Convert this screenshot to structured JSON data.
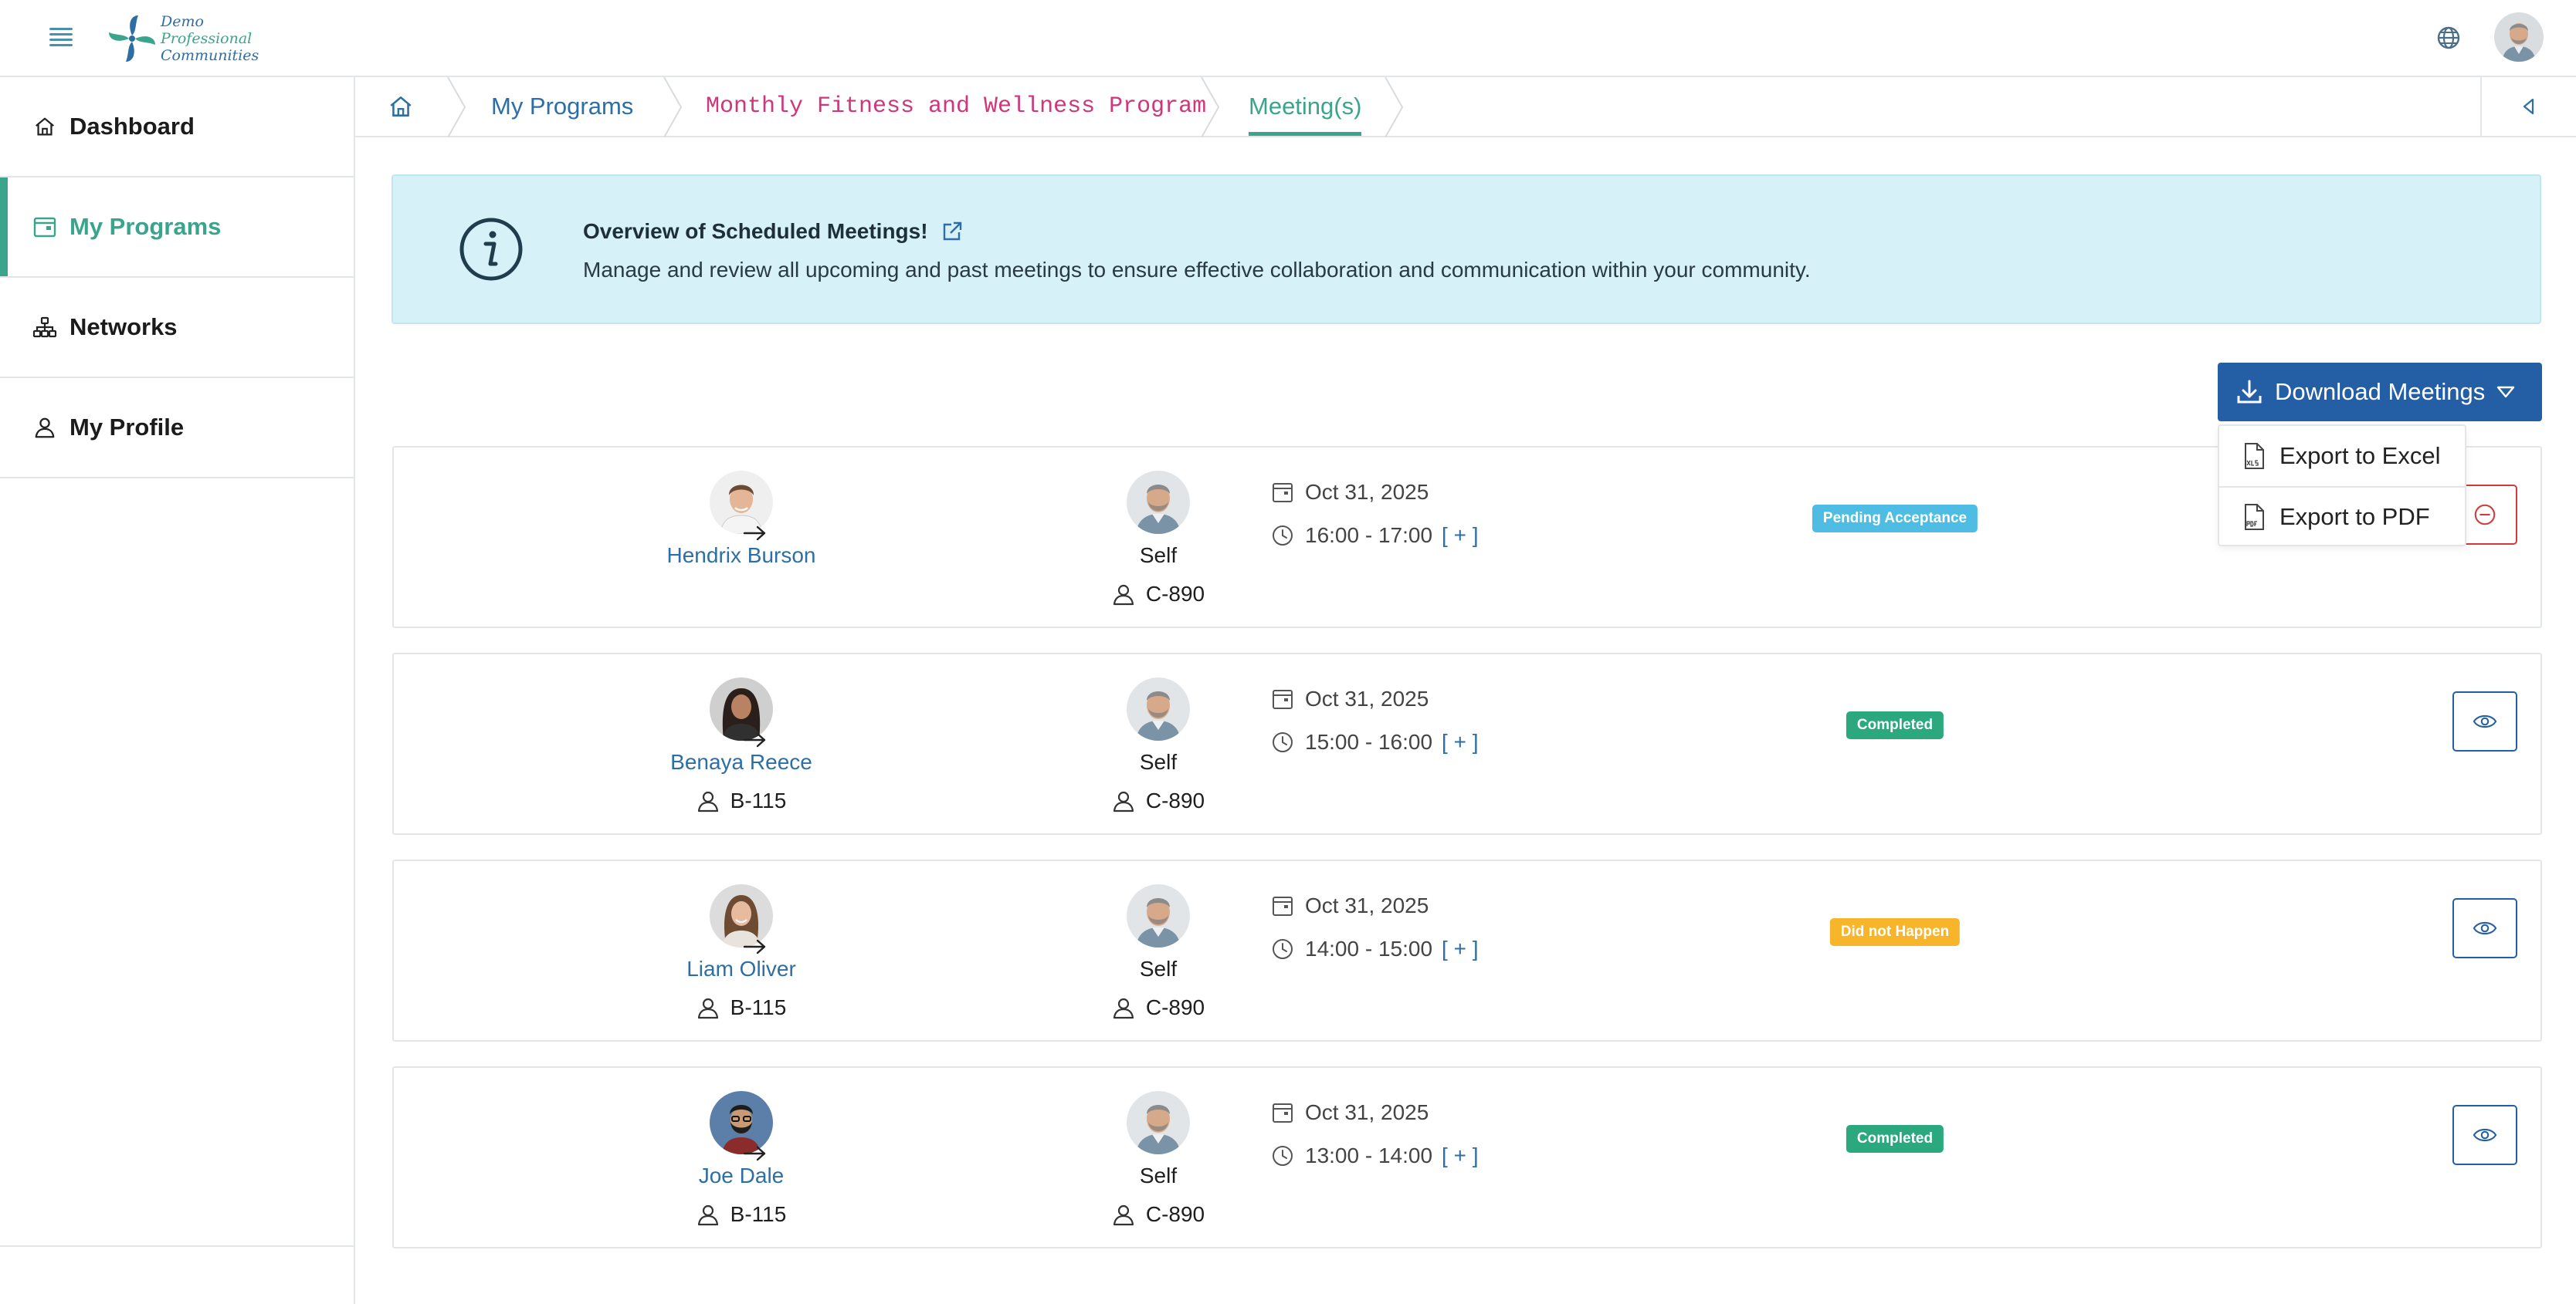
{
  "app": {
    "logo_line1": "Demo",
    "logo_line2": "Professional",
    "logo_line3": "Communities"
  },
  "icons": {
    "menu": "hamburger-menu-icon",
    "globe": "globe-icon",
    "home": "home-icon",
    "info": "info-icon",
    "external_link": "external-link-icon",
    "download": "download-icon",
    "calendar": "calendar-icon",
    "clock": "clock-icon",
    "user": "user-icon",
    "eye": "eye-icon",
    "cancel": "minus-circle-icon"
  },
  "colors": {
    "primary": "#245ea4",
    "accent": "#3aa48c",
    "link": "#2d6fa5",
    "pending": "#4fbce3",
    "completed": "#2ca87f",
    "not_happened": "#f6b52a",
    "danger": "#d23a3a",
    "banner_bg": "#d6f1f8"
  },
  "sidebar": {
    "items": [
      {
        "label": "Dashboard",
        "icon": "home-icon",
        "active": false
      },
      {
        "label": "My Programs",
        "icon": "calendar-icon",
        "active": true
      },
      {
        "label": "Networks",
        "icon": "network-icon",
        "active": false
      },
      {
        "label": "My Profile",
        "icon": "user-icon",
        "active": false
      }
    ]
  },
  "breadcrumb": {
    "programs": "My Programs",
    "program": "Monthly Fitness and Wellness Program",
    "current": "Meeting(s)"
  },
  "banner": {
    "title": "Overview of Scheduled Meetings!",
    "text": "Manage and review all upcoming and past meetings to ensure effective collaboration and communication within your community."
  },
  "download": {
    "label": "Download Meetings",
    "options": [
      {
        "label": "Export to Excel",
        "icon": "xls-file-icon"
      },
      {
        "label": "Export to PDF",
        "icon": "pdf-file-icon"
      }
    ]
  },
  "meetings": [
    {
      "mentee": "Hendrix Burson",
      "mentee_code": "",
      "mentor": "Self",
      "mentor_code": "C-890",
      "date": "Oct 31, 2025",
      "time": "16:00 - 17:00",
      "plus": "[ + ]",
      "status": "Pending Acceptance",
      "action": "cancel"
    },
    {
      "mentee": "Benaya Reece",
      "mentee_code": "B-115",
      "mentor": "Self",
      "mentor_code": "C-890",
      "date": "Oct 31, 2025",
      "time": "15:00 - 16:00",
      "plus": "[ + ]",
      "status": "Completed",
      "action": "view"
    },
    {
      "mentee": "Liam Oliver",
      "mentee_code": "B-115",
      "mentor": "Self",
      "mentor_code": "C-890",
      "date": "Oct 31, 2025",
      "time": "14:00 - 15:00",
      "plus": "[ + ]",
      "status": "Did not Happen",
      "action": "view"
    },
    {
      "mentee": "Joe Dale",
      "mentee_code": "B-115",
      "mentor": "Self",
      "mentor_code": "C-890",
      "date": "Oct 31, 2025",
      "time": "13:00 - 14:00",
      "plus": "[ + ]",
      "status": "Completed",
      "action": "view"
    }
  ]
}
